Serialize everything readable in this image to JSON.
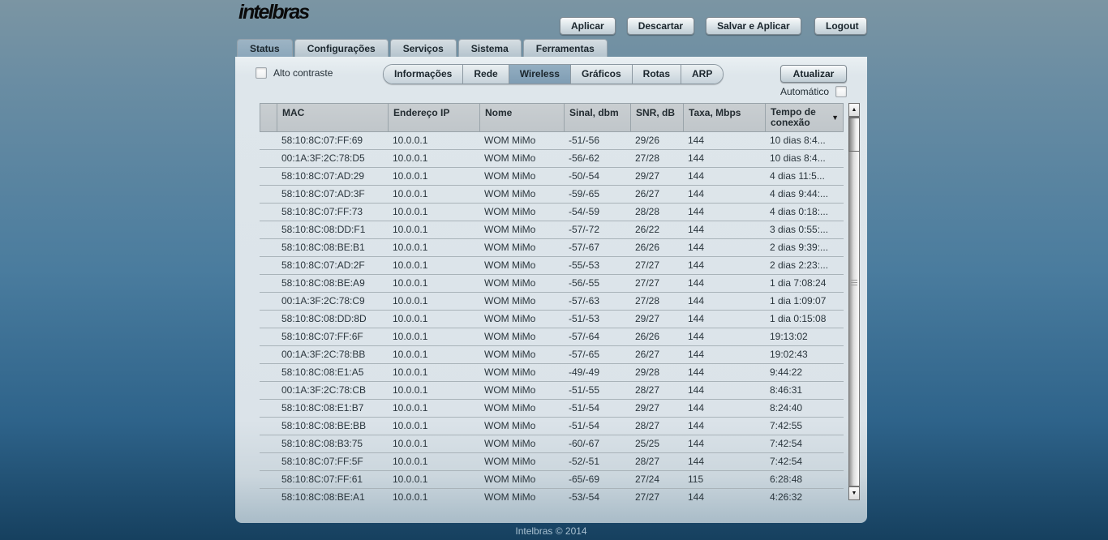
{
  "brand": {
    "logo": "intelbras",
    "footer": "Intelbras © 2014"
  },
  "top_buttons": {
    "aplicar": "Aplicar",
    "descartar": "Descartar",
    "salvar_e_aplicar": "Salvar e Aplicar",
    "logout": "Logout"
  },
  "tabs": [
    {
      "label": "Status",
      "active": true
    },
    {
      "label": "Configurações",
      "active": false
    },
    {
      "label": "Serviços",
      "active": false
    },
    {
      "label": "Sistema",
      "active": false
    },
    {
      "label": "Ferramentas",
      "active": false
    }
  ],
  "subtabs": [
    {
      "label": "Informações",
      "active": false
    },
    {
      "label": "Rede",
      "active": false
    },
    {
      "label": "Wireless",
      "active": true
    },
    {
      "label": "Gráficos",
      "active": false
    },
    {
      "label": "Rotas",
      "active": false
    },
    {
      "label": "ARP",
      "active": false
    }
  ],
  "controls": {
    "alto_contraste_label": "Alto contraste",
    "alto_contraste_checked": false,
    "atualizar_label": "Atualizar",
    "automatico_label": "Automático",
    "automatico_checked": false
  },
  "icons": {
    "sort_desc": "▼",
    "scroll_up": "▲",
    "scroll_down": "▼"
  },
  "table": {
    "columns": [
      "MAC",
      "Endereço IP",
      "Nome",
      "Sinal, dbm",
      "SNR, dB",
      "Taxa, Mbps",
      "Tempo de conexão"
    ],
    "sorted_by": "Tempo de conexão",
    "rows": [
      {
        "mac": "58:10:8C:07:FF:69",
        "ip": "10.0.0.1",
        "nome": "WOM MiMo",
        "sinal": "-51/-56",
        "snr": "29/26",
        "taxa": "144",
        "tempo": "10 dias 8:4..."
      },
      {
        "mac": "00:1A:3F:2C:78:D5",
        "ip": "10.0.0.1",
        "nome": "WOM MiMo",
        "sinal": "-56/-62",
        "snr": "27/28",
        "taxa": "144",
        "tempo": "10 dias 8:4..."
      },
      {
        "mac": "58:10:8C:07:AD:29",
        "ip": "10.0.0.1",
        "nome": "WOM MiMo",
        "sinal": "-50/-54",
        "snr": "29/27",
        "taxa": "144",
        "tempo": "4 dias 11:5..."
      },
      {
        "mac": "58:10:8C:07:AD:3F",
        "ip": "10.0.0.1",
        "nome": "WOM MiMo",
        "sinal": "-59/-65",
        "snr": "26/27",
        "taxa": "144",
        "tempo": "4 dias 9:44:..."
      },
      {
        "mac": "58:10:8C:07:FF:73",
        "ip": "10.0.0.1",
        "nome": "WOM MiMo",
        "sinal": "-54/-59",
        "snr": "28/28",
        "taxa": "144",
        "tempo": "4 dias 0:18:..."
      },
      {
        "mac": "58:10:8C:08:DD:F1",
        "ip": "10.0.0.1",
        "nome": "WOM MiMo",
        "sinal": "-57/-72",
        "snr": "26/22",
        "taxa": "144",
        "tempo": "3 dias 0:55:..."
      },
      {
        "mac": "58:10:8C:08:BE:B1",
        "ip": "10.0.0.1",
        "nome": "WOM MiMo",
        "sinal": "-57/-67",
        "snr": "26/26",
        "taxa": "144",
        "tempo": "2 dias 9:39:..."
      },
      {
        "mac": "58:10:8C:07:AD:2F",
        "ip": "10.0.0.1",
        "nome": "WOM MiMo",
        "sinal": "-55/-53",
        "snr": "27/27",
        "taxa": "144",
        "tempo": "2 dias 2:23:..."
      },
      {
        "mac": "58:10:8C:08:BE:A9",
        "ip": "10.0.0.1",
        "nome": "WOM MiMo",
        "sinal": "-56/-55",
        "snr": "27/27",
        "taxa": "144",
        "tempo": "1 dia 7:08:24"
      },
      {
        "mac": "00:1A:3F:2C:78:C9",
        "ip": "10.0.0.1",
        "nome": "WOM MiMo",
        "sinal": "-57/-63",
        "snr": "27/28",
        "taxa": "144",
        "tempo": "1 dia 1:09:07"
      },
      {
        "mac": "58:10:8C:08:DD:8D",
        "ip": "10.0.0.1",
        "nome": "WOM MiMo",
        "sinal": "-51/-53",
        "snr": "29/27",
        "taxa": "144",
        "tempo": "1 dia 0:15:08"
      },
      {
        "mac": "58:10:8C:07:FF:6F",
        "ip": "10.0.0.1",
        "nome": "WOM MiMo",
        "sinal": "-57/-64",
        "snr": "26/26",
        "taxa": "144",
        "tempo": "19:13:02"
      },
      {
        "mac": "00:1A:3F:2C:78:BB",
        "ip": "10.0.0.1",
        "nome": "WOM MiMo",
        "sinal": "-57/-65",
        "snr": "26/27",
        "taxa": "144",
        "tempo": "19:02:43"
      },
      {
        "mac": "58:10:8C:08:E1:A5",
        "ip": "10.0.0.1",
        "nome": "WOM MiMo",
        "sinal": "-49/-49",
        "snr": "29/28",
        "taxa": "144",
        "tempo": "9:44:22"
      },
      {
        "mac": "00:1A:3F:2C:78:CB",
        "ip": "10.0.0.1",
        "nome": "WOM MiMo",
        "sinal": "-51/-55",
        "snr": "28/27",
        "taxa": "144",
        "tempo": "8:46:31"
      },
      {
        "mac": "58:10:8C:08:E1:B7",
        "ip": "10.0.0.1",
        "nome": "WOM MiMo",
        "sinal": "-51/-54",
        "snr": "29/27",
        "taxa": "144",
        "tempo": "8:24:40"
      },
      {
        "mac": "58:10:8C:08:BE:BB",
        "ip": "10.0.0.1",
        "nome": "WOM MiMo",
        "sinal": "-51/-54",
        "snr": "28/27",
        "taxa": "144",
        "tempo": "7:42:55"
      },
      {
        "mac": "58:10:8C:08:B3:75",
        "ip": "10.0.0.1",
        "nome": "WOM MiMo",
        "sinal": "-60/-67",
        "snr": "25/25",
        "taxa": "144",
        "tempo": "7:42:54"
      },
      {
        "mac": "58:10:8C:07:FF:5F",
        "ip": "10.0.0.1",
        "nome": "WOM MiMo",
        "sinal": "-52/-51",
        "snr": "28/27",
        "taxa": "144",
        "tempo": "7:42:54"
      },
      {
        "mac": "58:10:8C:07:FF:61",
        "ip": "10.0.0.1",
        "nome": "WOM MiMo",
        "sinal": "-65/-69",
        "snr": "27/24",
        "taxa": "115",
        "tempo": "6:28:48"
      },
      {
        "mac": "58:10:8C:08:BE:A1",
        "ip": "10.0.0.1",
        "nome": "WOM MiMo",
        "sinal": "-53/-54",
        "snr": "27/27",
        "taxa": "144",
        "tempo": "4:26:32"
      }
    ]
  },
  "colors": {
    "page_gradient_top": "#7B95A3",
    "page_gradient_mid": "#4A7C9E",
    "page_gradient_bottom": "#16405F",
    "panel_bg": "#DBE3E9",
    "active_tab": "#8BA7BB",
    "active_subtab": "#7F9DB4",
    "table_header_bg": "#C0C6CA",
    "row_separator": "#A9B3B9",
    "footer_text": "#A9C1D1"
  }
}
